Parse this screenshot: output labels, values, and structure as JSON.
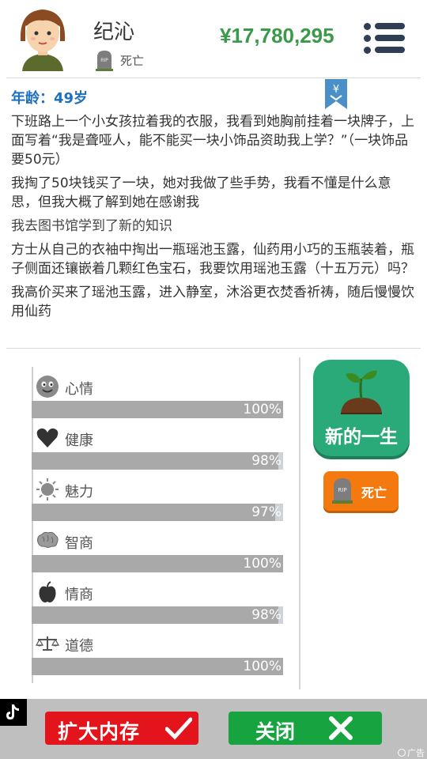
{
  "header": {
    "name": "纪沁",
    "status": "死亡",
    "money": "¥17,780,295"
  },
  "log": {
    "age": "年龄：49岁",
    "entries": [
      "下班路上一个小女孩拉着我的衣服，我看到她胸前挂着一块牌子，上面写着“我是聋哑人，能不能买一块小饰品资助我上学？”（一块饰品要50元）",
      "我掏了50块钱买了一块，她对我做了些手势，我看不懂是什么意思，但我大概了解到她在感谢我",
      "我去图书馆学到了新的知识",
      "方士从自己的衣袖中掏出一瓶瑶池玉露，仙药用小巧的玉瓶装着，瓶子侧面还镶嵌着几颗红色宝石，我要饮用瑶池玉露（十五万元）吗？",
      "我高价买来了瑶池玉露，进入静室，沐浴更衣焚香祈祷，随后慢慢饮用仙药"
    ]
  },
  "bookmark_symbol": "¥",
  "stats": [
    {
      "label": "心情",
      "value": "100%",
      "level": 100,
      "icon": "smiley-icon"
    },
    {
      "label": "健康",
      "value": "98%",
      "level": 98,
      "icon": "heart-icon"
    },
    {
      "label": "魅力",
      "value": "97%",
      "level": 97,
      "icon": "sun-icon"
    },
    {
      "label": "智商",
      "value": "100%",
      "level": 100,
      "icon": "brain-icon"
    },
    {
      "label": "情商",
      "value": "98%",
      "level": 98,
      "icon": "apple-icon"
    },
    {
      "label": "道德",
      "value": "100%",
      "level": 100,
      "icon": "scales-icon"
    }
  ],
  "actions": {
    "new_life": "新的一生",
    "death": "死亡"
  },
  "ad": {
    "expand_label": "扩大内存",
    "close_label": "关闭",
    "ad_tag": "广告"
  },
  "colors": {
    "money": "#3a9a49",
    "age": "#1d6fc0",
    "new_life_bg": "#2aa979",
    "death_bg": "#f47a10",
    "expand_bg": "#e3141b",
    "close_bg": "#17a340"
  }
}
